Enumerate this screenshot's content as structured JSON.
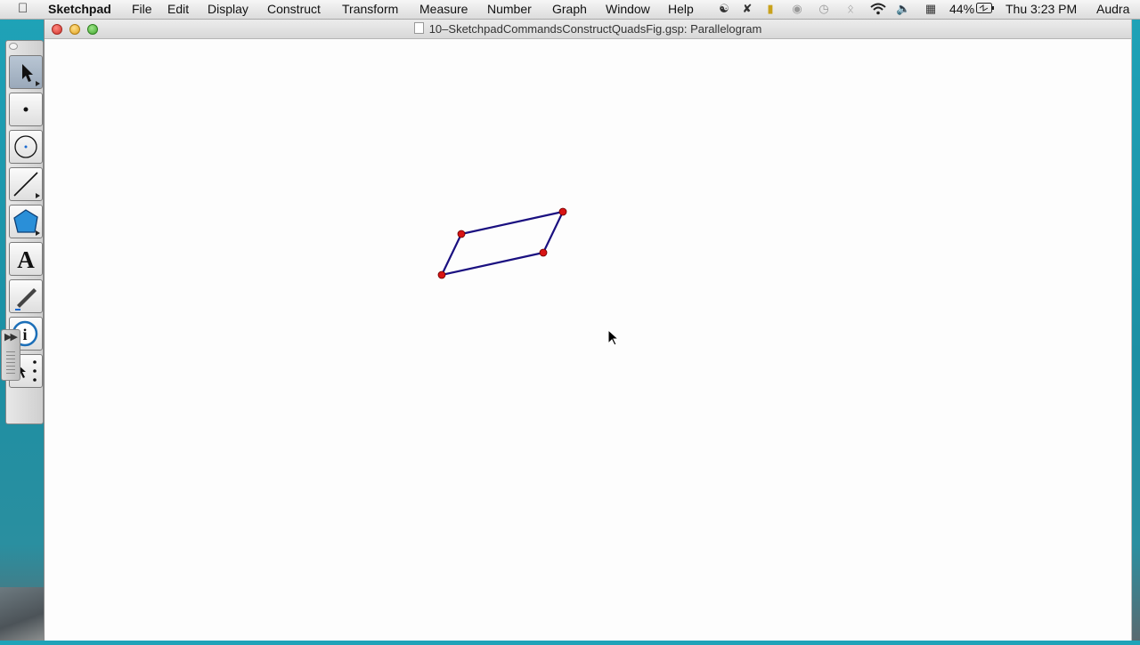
{
  "menubar": {
    "app_name": "Sketchpad",
    "menus": [
      "File",
      "Edit",
      "Display",
      "Construct",
      "Transform",
      "Measure",
      "Number",
      "Graph",
      "Window",
      "Help"
    ],
    "battery": "44%",
    "clock": "Thu 3:23 PM",
    "user": "Audra"
  },
  "window": {
    "title": "10–SketchpadCommandsConstructQuadsFig.gsp: Parallelogram"
  },
  "toolbox": {
    "tools": [
      {
        "name": "arrow-tool",
        "selected": true
      },
      {
        "name": "point-tool"
      },
      {
        "name": "compass-tool"
      },
      {
        "name": "straightedge-tool"
      },
      {
        "name": "polygon-tool"
      },
      {
        "name": "text-tool",
        "label": "A"
      },
      {
        "name": "marker-tool"
      },
      {
        "name": "information-tool"
      },
      {
        "name": "custom-tool"
      }
    ]
  },
  "sketch": {
    "shape": "parallelogram",
    "stroke_color": "#1a1080",
    "point_color": "#d81414"
  }
}
